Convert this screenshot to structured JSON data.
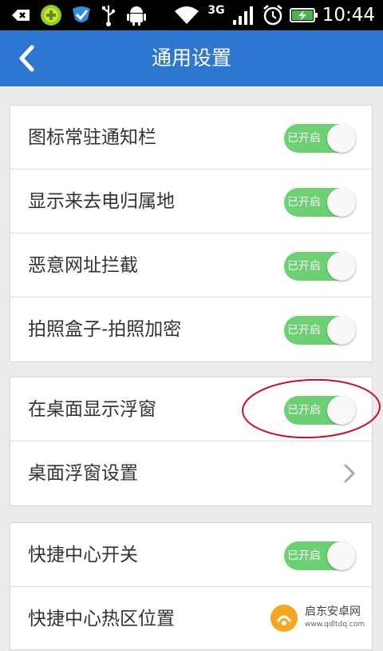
{
  "status_bar": {
    "time": "10:44",
    "network": "3G",
    "icons": [
      "back-arrow-icon",
      "plus-badge-icon",
      "shield-check-icon",
      "usb-icon",
      "android-icon",
      "wifi-icon",
      "signal-icon",
      "alarm-icon",
      "battery-charging-icon"
    ]
  },
  "header": {
    "title": "通用设置",
    "back_icon": "chevron-left-icon"
  },
  "groups": [
    {
      "rows": [
        {
          "label": "图标常驻通知栏",
          "toggle": "已开启",
          "enabled": true
        },
        {
          "label": "显示来去电归属地",
          "toggle": "已开启",
          "enabled": true
        },
        {
          "label": "恶意网址拦截",
          "toggle": "已开启",
          "enabled": true
        },
        {
          "label": "拍照盒子-拍照加密",
          "toggle": "已开启",
          "enabled": true
        }
      ]
    },
    {
      "rows": [
        {
          "label": "在桌面显示浮窗",
          "toggle": "已开启",
          "enabled": true
        },
        {
          "label": "桌面浮窗设置",
          "chevron": "chevron-right-icon"
        }
      ]
    },
    {
      "rows": [
        {
          "label": "快捷中心开关",
          "toggle": "已开启",
          "enabled": true
        },
        {
          "label": "快捷中心热区位置"
        }
      ]
    }
  ],
  "colors": {
    "title_bar": "#2d77d0",
    "toggle_on": "#6bd172",
    "annotation": "#c8102e"
  },
  "watermark": {
    "name": "启东安卓网",
    "url": "www.qdltdq.com"
  }
}
